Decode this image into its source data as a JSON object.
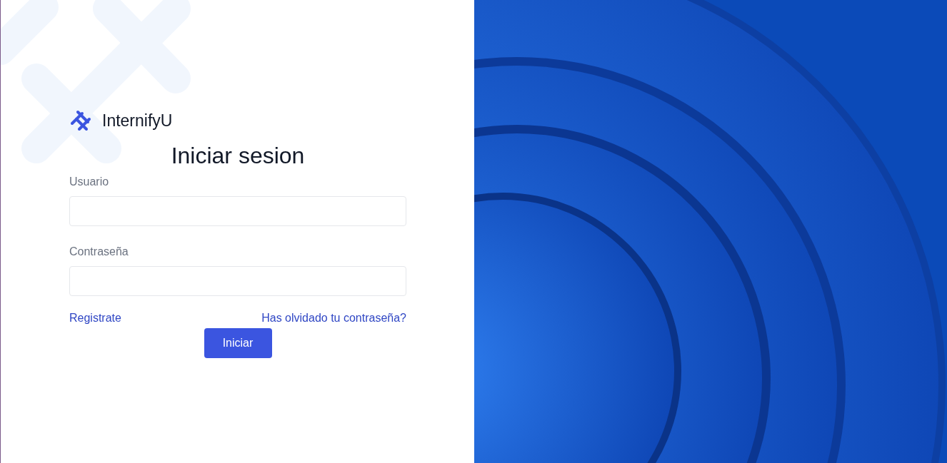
{
  "brand": {
    "name": "InternifyU"
  },
  "title": "Iniciar sesion",
  "fields": [
    {
      "label": "Usuario"
    },
    {
      "label": "Contraseña"
    }
  ],
  "links": [
    "Registrate",
    "Has olvidado tu contraseña?"
  ],
  "submit": "Iniciar"
}
